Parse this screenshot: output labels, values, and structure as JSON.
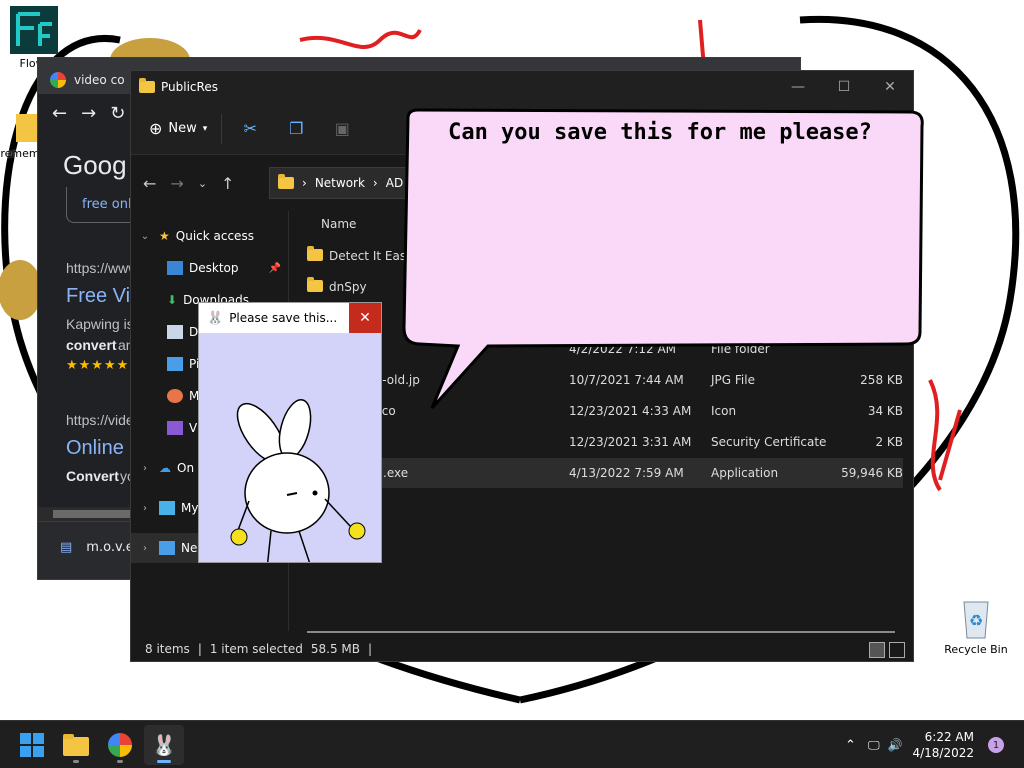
{
  "desktop": {
    "icons": [
      {
        "label": "Flowf",
        "name": "flowframes-shortcut"
      },
      {
        "label": "remem",
        "name": "desktop-folder-shortcut"
      },
      {
        "label": "Recycle Bin",
        "name": "recycle-bin"
      }
    ]
  },
  "chrome": {
    "tab_title": "video co",
    "logo_text": "Goog",
    "free_chip": "free onl",
    "result1": {
      "url": "https://www",
      "title": "Free Vi",
      "snippet": "Kapwing is",
      "bold": "convert",
      "bold_tail": "an",
      "stars": "★★★★★"
    },
    "result2": {
      "url": "https://vide",
      "title": "Online",
      "bold": "Convert",
      "snippet_tail": "yo"
    },
    "download_name": "m.o.v.e"
  },
  "explorer": {
    "title": "PublicRes",
    "new_label": "New",
    "address": {
      "seg1": "Network",
      "seg2": "AD"
    },
    "nav": {
      "quick_access": "Quick access",
      "desktop": "Desktop",
      "downloads": "Downloads",
      "documents": "D",
      "pictures": "Pi",
      "music": "M",
      "videos": "Vi",
      "onedrive": "On",
      "this_pc": "My",
      "network": "Ne"
    },
    "column_name": "Name",
    "files": [
      {
        "name": "Detect It Easy",
        "date": "",
        "type": "",
        "size": ""
      },
      {
        "name": "dnSpy",
        "date": "",
        "type": "",
        "size": ""
      },
      {
        "name": "",
        "date": "4/2/2022 7:12 AM",
        "type": "File folder",
        "size": ""
      },
      {
        "name": "nd-old.jp",
        "date": "10/7/2021 7:44 AM",
        "type": "JPG File",
        "size": "258 KB"
      },
      {
        "name": "n.ico",
        "date": "12/23/2021 4:33 AM",
        "type": "Icon",
        "size": "34 KB"
      },
      {
        "name": "",
        "date": "12/23/2021 3:31 AM",
        "type": "Security Certificate",
        "size": "2 KB"
      },
      {
        "name": ".exe",
        "date": "4/13/2022 7:59 AM",
        "type": "Application",
        "size": "59,946 KB"
      }
    ],
    "status": {
      "items": "8 items",
      "selected": "1 item selected",
      "size": "58.5 MB"
    }
  },
  "bubble": {
    "text": "Can you save this for me please?"
  },
  "popup": {
    "title": "Please save this..."
  },
  "taskbar": {
    "time": "6:22 AM",
    "date": "4/18/2022",
    "notification_count": "1"
  }
}
